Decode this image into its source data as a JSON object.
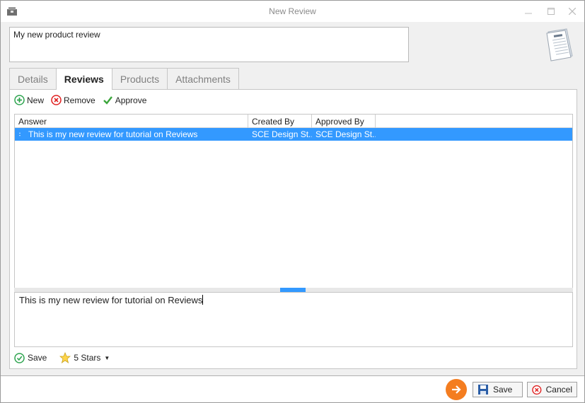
{
  "window": {
    "title": "New Review"
  },
  "review_name": "My new product review",
  "tabs": [
    {
      "label": "Details",
      "active": false
    },
    {
      "label": "Reviews",
      "active": true
    },
    {
      "label": "Products",
      "active": false
    },
    {
      "label": "Attachments",
      "active": false
    }
  ],
  "toolbar": {
    "new_label": "New",
    "remove_label": "Remove",
    "approve_label": "Approve"
  },
  "grid": {
    "columns": [
      "Answer",
      "Created By",
      "Approved By"
    ],
    "rows": [
      {
        "answer": "This is my new review for tutorial on Reviews",
        "created_by": "SCE Design St...",
        "approved_by": "SCE Design St..."
      }
    ]
  },
  "editor": {
    "text": "This is my new review for tutorial on Reviews"
  },
  "bottom": {
    "save_label": "Save",
    "rating_label": "5 Stars"
  },
  "footer": {
    "save_label": "Save",
    "cancel_label": "Cancel"
  },
  "colors": {
    "selection": "#3399ff",
    "accent_orange": "#f47d20",
    "add_green": "#2ea44f",
    "remove_red": "#e02020"
  }
}
